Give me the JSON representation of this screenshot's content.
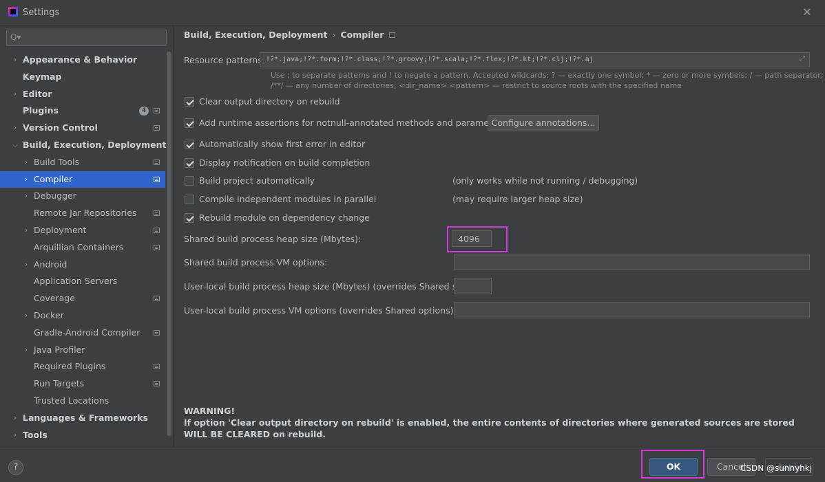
{
  "window": {
    "title": "Settings"
  },
  "sidebar": {
    "search_placeholder": "Q▾",
    "items": [
      {
        "label": "Appearance & Behavior",
        "level": 0,
        "chevron": ">"
      },
      {
        "label": "Keymap",
        "level": 0,
        "chevron": ""
      },
      {
        "label": "Editor",
        "level": 0,
        "chevron": ">"
      },
      {
        "label": "Plugins",
        "level": 0,
        "chevron": "",
        "badge": "4"
      },
      {
        "label": "Version Control",
        "level": 0,
        "chevron": ">"
      },
      {
        "label": "Build, Execution, Deployment",
        "level": 0,
        "chevron": "v"
      },
      {
        "label": "Build Tools",
        "level": 1,
        "chevron": ">"
      },
      {
        "label": "Compiler",
        "level": 1,
        "chevron": ">",
        "selected": true
      },
      {
        "label": "Debugger",
        "level": 1,
        "chevron": ">"
      },
      {
        "label": "Remote Jar Repositories",
        "level": 1,
        "chevron": ""
      },
      {
        "label": "Deployment",
        "level": 1,
        "chevron": ">"
      },
      {
        "label": "Arquillian Containers",
        "level": 1,
        "chevron": ""
      },
      {
        "label": "Android",
        "level": 1,
        "chevron": ">"
      },
      {
        "label": "Application Servers",
        "level": 1,
        "chevron": ""
      },
      {
        "label": "Coverage",
        "level": 1,
        "chevron": ""
      },
      {
        "label": "Docker",
        "level": 1,
        "chevron": ">"
      },
      {
        "label": "Gradle-Android Compiler",
        "level": 1,
        "chevron": ""
      },
      {
        "label": "Java Profiler",
        "level": 1,
        "chevron": ">"
      },
      {
        "label": "Required Plugins",
        "level": 1,
        "chevron": ""
      },
      {
        "label": "Run Targets",
        "level": 1,
        "chevron": ""
      },
      {
        "label": "Trusted Locations",
        "level": 1,
        "chevron": ""
      },
      {
        "label": "Languages & Frameworks",
        "level": 0,
        "chevron": ">"
      },
      {
        "label": "Tools",
        "level": 0,
        "chevron": ">"
      }
    ]
  },
  "main": {
    "breadcrumb": {
      "parent": "Build, Execution, Deployment",
      "separator": "›",
      "current": "Compiler"
    },
    "resource_patterns": {
      "label": "Resource patterns:",
      "value": "!?*.java;!?*.form;!?*.class;!?*.groovy;!?*.scala;!?*.flex;!?*.kt;!?*.clj;!?*.aj",
      "hint_line1": "Use ; to separate patterns and ! to negate a pattern. Accepted wildcards: ? — exactly one symbol; * — zero or more symbols; / — path separator;",
      "hint_line2": "/**/ — any number of directories; <dir_name>:<pattern> — restrict to source roots with the specified name"
    },
    "options": {
      "clear_output": "Clear output directory on rebuild",
      "add_assertions": "Add runtime assertions for notnull-annotated methods and parameters",
      "configure_annotations": "Configure annotations...",
      "show_first_error": "Automatically show first error in editor",
      "display_notification": "Display notification on build completion",
      "build_automatically": "Build project automatically",
      "build_automatically_note": "(only works while not running / debugging)",
      "compile_parallel": "Compile independent modules in parallel",
      "compile_parallel_note": "(may require larger heap size)",
      "rebuild_on_dependency": "Rebuild module on dependency change"
    },
    "heap": {
      "label": "Shared build process heap size (Mbytes):",
      "value": "4096"
    },
    "vm_options": {
      "label": "Shared build process VM options:",
      "value": ""
    },
    "user_heap": {
      "label": "User-local build process heap size (Mbytes) (overrides Shared size):",
      "value": ""
    },
    "user_vm": {
      "label": "User-local build process VM options (overrides Shared options):",
      "value": ""
    },
    "warning": {
      "title": "WARNING!",
      "text": "If option 'Clear output directory on rebuild' is enabled, the entire contents of directories where generated sources are stored WILL BE CLEARED on rebuild."
    }
  },
  "footer": {
    "help": "?",
    "ok": "OK",
    "cancel": "Cancel",
    "apply": "Apply",
    "watermark": "CSDN @sunnyhkj"
  }
}
